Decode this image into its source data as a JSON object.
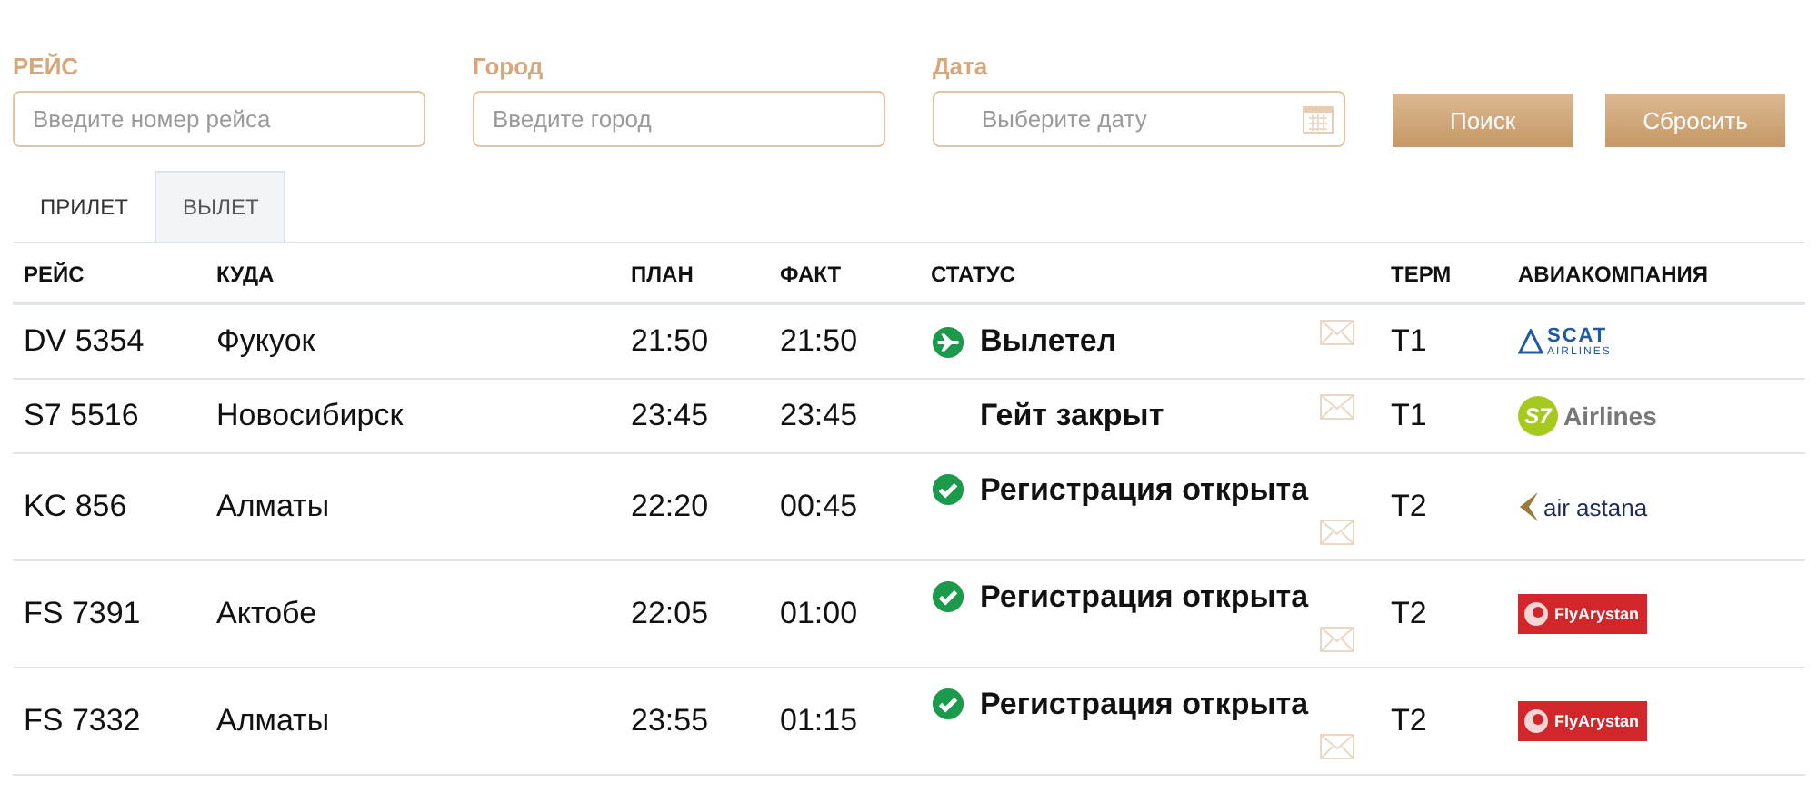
{
  "filters": [
    {
      "kind": "text",
      "label": "РЕЙС",
      "placeholder": "Введите номер рейса"
    },
    {
      "kind": "text",
      "label": "Город",
      "placeholder": "Введите город"
    },
    {
      "kind": "date",
      "label": "Дата",
      "placeholder": "Выберите дату"
    }
  ],
  "buttons": [
    "Поиск",
    "Сбросить"
  ],
  "tabs": [
    {
      "label": "ПРИЛЕТ",
      "selected": false
    },
    {
      "label": "ВЫЛЕТ",
      "selected": true
    }
  ],
  "table": {
    "columns": [
      "РЕЙС",
      "КУДА",
      "ПЛАН",
      "ФАКТ",
      "СТАТУС",
      "ТЕРМ",
      "АВИАКОМПАНИЯ"
    ],
    "rows": [
      {
        "flight": "DV 5354",
        "destination": "Фукуок",
        "plan": "21:50",
        "fact": "21:50",
        "status": {
          "kind": "departed",
          "text": "Вылетел"
        },
        "terminal": "T1",
        "airline": {
          "kind": "scat",
          "name": "SCAT",
          "sub": "AIRLINES"
        }
      },
      {
        "flight": "S7 5516",
        "destination": "Новосибирск",
        "plan": "23:45",
        "fact": "23:45",
        "status": {
          "kind": "none",
          "text": "Гейт закрыт"
        },
        "terminal": "T1",
        "airline": {
          "kind": "s7",
          "mark": "S7",
          "name": "Airlines"
        }
      },
      {
        "flight": "KC 856",
        "destination": "Алматы",
        "plan": "22:20",
        "fact": "00:45",
        "status": {
          "kind": "checkin",
          "text": "Регистрация открыта"
        },
        "terminal": "T2",
        "airline": {
          "kind": "astana",
          "name": "air astana"
        }
      },
      {
        "flight": "FS 7391",
        "destination": "Актобе",
        "plan": "22:05",
        "fact": "01:00",
        "status": {
          "kind": "checkin",
          "text": "Регистрация открыта"
        },
        "terminal": "T2",
        "airline": {
          "kind": "flyarystan",
          "name": "FlyArystan"
        }
      },
      {
        "flight": "FS 7332",
        "destination": "Алматы",
        "plan": "23:55",
        "fact": "01:15",
        "status": {
          "kind": "checkin",
          "text": "Регистрация открыта"
        },
        "terminal": "T2",
        "airline": {
          "kind": "flyarystan",
          "name": "FlyArystan"
        }
      }
    ]
  }
}
